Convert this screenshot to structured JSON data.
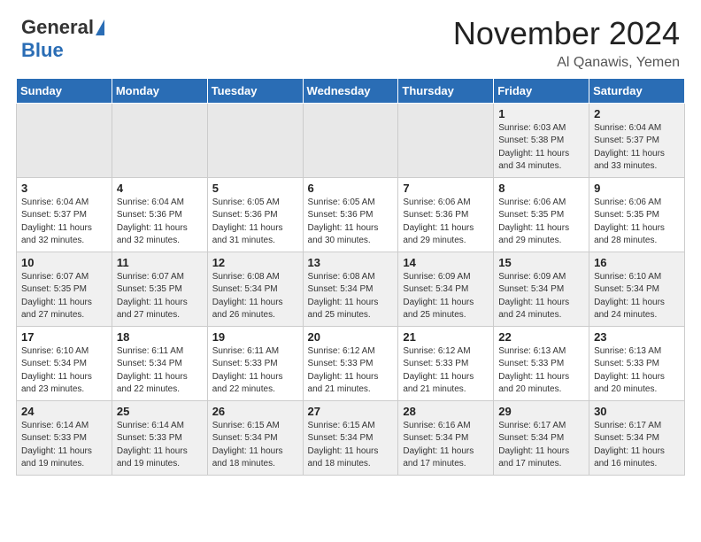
{
  "header": {
    "logo_general": "General",
    "logo_blue": "Blue",
    "month": "November 2024",
    "location": "Al Qanawis, Yemen"
  },
  "weekdays": [
    "Sunday",
    "Monday",
    "Tuesday",
    "Wednesday",
    "Thursday",
    "Friday",
    "Saturday"
  ],
  "weeks": [
    [
      {
        "day": "",
        "info": ""
      },
      {
        "day": "",
        "info": ""
      },
      {
        "day": "",
        "info": ""
      },
      {
        "day": "",
        "info": ""
      },
      {
        "day": "",
        "info": ""
      },
      {
        "day": "1",
        "info": "Sunrise: 6:03 AM\nSunset: 5:38 PM\nDaylight: 11 hours\nand 34 minutes."
      },
      {
        "day": "2",
        "info": "Sunrise: 6:04 AM\nSunset: 5:37 PM\nDaylight: 11 hours\nand 33 minutes."
      }
    ],
    [
      {
        "day": "3",
        "info": "Sunrise: 6:04 AM\nSunset: 5:37 PM\nDaylight: 11 hours\nand 32 minutes."
      },
      {
        "day": "4",
        "info": "Sunrise: 6:04 AM\nSunset: 5:36 PM\nDaylight: 11 hours\nand 32 minutes."
      },
      {
        "day": "5",
        "info": "Sunrise: 6:05 AM\nSunset: 5:36 PM\nDaylight: 11 hours\nand 31 minutes."
      },
      {
        "day": "6",
        "info": "Sunrise: 6:05 AM\nSunset: 5:36 PM\nDaylight: 11 hours\nand 30 minutes."
      },
      {
        "day": "7",
        "info": "Sunrise: 6:06 AM\nSunset: 5:36 PM\nDaylight: 11 hours\nand 29 minutes."
      },
      {
        "day": "8",
        "info": "Sunrise: 6:06 AM\nSunset: 5:35 PM\nDaylight: 11 hours\nand 29 minutes."
      },
      {
        "day": "9",
        "info": "Sunrise: 6:06 AM\nSunset: 5:35 PM\nDaylight: 11 hours\nand 28 minutes."
      }
    ],
    [
      {
        "day": "10",
        "info": "Sunrise: 6:07 AM\nSunset: 5:35 PM\nDaylight: 11 hours\nand 27 minutes."
      },
      {
        "day": "11",
        "info": "Sunrise: 6:07 AM\nSunset: 5:35 PM\nDaylight: 11 hours\nand 27 minutes."
      },
      {
        "day": "12",
        "info": "Sunrise: 6:08 AM\nSunset: 5:34 PM\nDaylight: 11 hours\nand 26 minutes."
      },
      {
        "day": "13",
        "info": "Sunrise: 6:08 AM\nSunset: 5:34 PM\nDaylight: 11 hours\nand 25 minutes."
      },
      {
        "day": "14",
        "info": "Sunrise: 6:09 AM\nSunset: 5:34 PM\nDaylight: 11 hours\nand 25 minutes."
      },
      {
        "day": "15",
        "info": "Sunrise: 6:09 AM\nSunset: 5:34 PM\nDaylight: 11 hours\nand 24 minutes."
      },
      {
        "day": "16",
        "info": "Sunrise: 6:10 AM\nSunset: 5:34 PM\nDaylight: 11 hours\nand 24 minutes."
      }
    ],
    [
      {
        "day": "17",
        "info": "Sunrise: 6:10 AM\nSunset: 5:34 PM\nDaylight: 11 hours\nand 23 minutes."
      },
      {
        "day": "18",
        "info": "Sunrise: 6:11 AM\nSunset: 5:34 PM\nDaylight: 11 hours\nand 22 minutes."
      },
      {
        "day": "19",
        "info": "Sunrise: 6:11 AM\nSunset: 5:33 PM\nDaylight: 11 hours\nand 22 minutes."
      },
      {
        "day": "20",
        "info": "Sunrise: 6:12 AM\nSunset: 5:33 PM\nDaylight: 11 hours\nand 21 minutes."
      },
      {
        "day": "21",
        "info": "Sunrise: 6:12 AM\nSunset: 5:33 PM\nDaylight: 11 hours\nand 21 minutes."
      },
      {
        "day": "22",
        "info": "Sunrise: 6:13 AM\nSunset: 5:33 PM\nDaylight: 11 hours\nand 20 minutes."
      },
      {
        "day": "23",
        "info": "Sunrise: 6:13 AM\nSunset: 5:33 PM\nDaylight: 11 hours\nand 20 minutes."
      }
    ],
    [
      {
        "day": "24",
        "info": "Sunrise: 6:14 AM\nSunset: 5:33 PM\nDaylight: 11 hours\nand 19 minutes."
      },
      {
        "day": "25",
        "info": "Sunrise: 6:14 AM\nSunset: 5:33 PM\nDaylight: 11 hours\nand 19 minutes."
      },
      {
        "day": "26",
        "info": "Sunrise: 6:15 AM\nSunset: 5:34 PM\nDaylight: 11 hours\nand 18 minutes."
      },
      {
        "day": "27",
        "info": "Sunrise: 6:15 AM\nSunset: 5:34 PM\nDaylight: 11 hours\nand 18 minutes."
      },
      {
        "day": "28",
        "info": "Sunrise: 6:16 AM\nSunset: 5:34 PM\nDaylight: 11 hours\nand 17 minutes."
      },
      {
        "day": "29",
        "info": "Sunrise: 6:17 AM\nSunset: 5:34 PM\nDaylight: 11 hours\nand 17 minutes."
      },
      {
        "day": "30",
        "info": "Sunrise: 6:17 AM\nSunset: 5:34 PM\nDaylight: 11 hours\nand 16 minutes."
      }
    ]
  ]
}
